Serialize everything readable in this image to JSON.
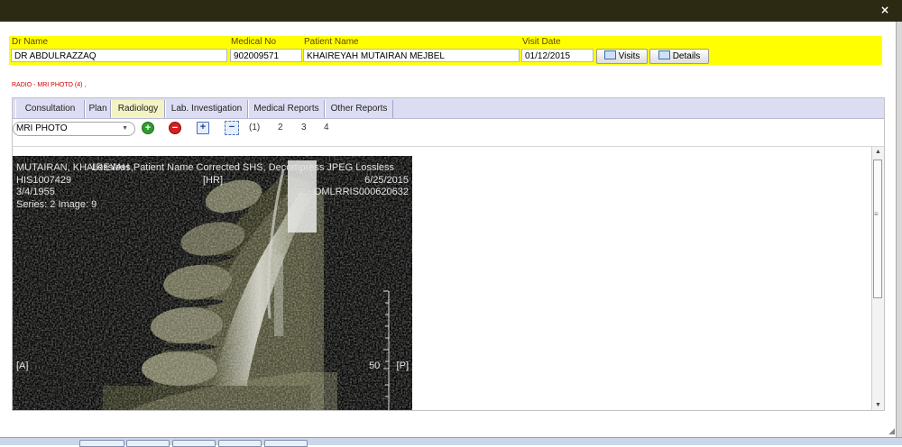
{
  "window": {
    "close_glyph": "×"
  },
  "header": {
    "dr_name_label": "Dr Name",
    "dr_name_value": "DR ABDULRAZZAQ",
    "medical_no_label": "Medical No",
    "medical_no_value": "902009571",
    "patient_name_label": "Patient Name",
    "patient_name_value": "KHAIREYAH MUTAIRAN MEJBEL",
    "visit_date_label": "Visit Date",
    "visit_date_value": "01/12/2015",
    "visits_button": "Visits",
    "details_button": "Details"
  },
  "breadcrumb": "RADIO - MRI PHOTO (4) ,",
  "tabs": [
    {
      "label": "Consultation",
      "active": false
    },
    {
      "label": "Plan",
      "active": false
    },
    {
      "label": "Radiology",
      "active": true
    },
    {
      "label": "Lab. Investigation",
      "active": false
    },
    {
      "label": "Medical Reports",
      "active": false
    },
    {
      "label": "Other Reports",
      "active": false
    }
  ],
  "toolbar": {
    "selected_photo_type": "MRI PHOTO",
    "pages": [
      "(1)",
      "2",
      "3",
      "4"
    ]
  },
  "image": {
    "line1": "MUTAIRAN, KHAIREYAH",
    "line1_overlay": "Lossless,Patient Name Corrected SHS, Decompress JPEG Lossless",
    "patient_id": "HIS1007429",
    "birth_date": "3/4/1955",
    "series": "Series: 2 Image: 9",
    "hr_marker": "[HR]",
    "study_date": "6/25/2015",
    "accession": "OMLRRIS000620632",
    "left_marker": "[A]",
    "right_marker": "[P]",
    "scale_label": "50"
  },
  "colors": {
    "title_bar": "#2d2a14",
    "header_band": "#ffff00",
    "breadcrumb": "#d00000",
    "tab_strip": "#dcdcf2",
    "active_tab": "#f3f3c4"
  }
}
